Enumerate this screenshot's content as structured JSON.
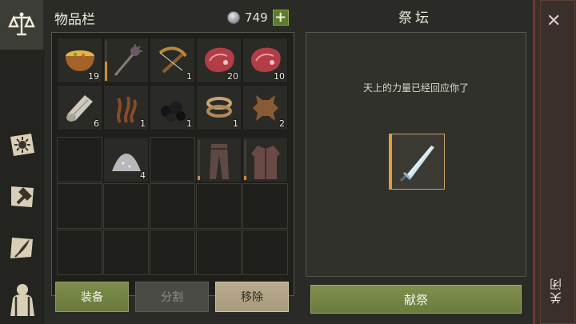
{
  "tabs": [
    {
      "icon": "scales-icon",
      "active": true
    },
    {
      "icon": "sun-scroll-icon",
      "active": false
    },
    {
      "icon": "hammer-icon",
      "active": false
    },
    {
      "icon": "quill-scroll-icon",
      "active": false
    },
    {
      "icon": "character-icon",
      "active": false
    }
  ],
  "inventory": {
    "title": "物品栏",
    "currency_value": "749",
    "plus_label": "+",
    "items_top": [
      {
        "name": "soup-bowl",
        "count": "19"
      },
      {
        "name": "mace",
        "count": "",
        "durability": 0.5
      },
      {
        "name": "crossbow",
        "count": "1"
      },
      {
        "name": "raw-meat",
        "count": "20"
      },
      {
        "name": "raw-meat",
        "count": "10"
      },
      {
        "name": "cloth-roll",
        "count": "6"
      },
      {
        "name": "seaweed",
        "count": "1"
      },
      {
        "name": "coal",
        "count": "1"
      },
      {
        "name": "rope",
        "count": "1"
      },
      {
        "name": "leather-hide",
        "count": "2"
      }
    ],
    "items_bottom": [
      {
        "name": "",
        "count": ""
      },
      {
        "name": "powder-pile",
        "count": "4"
      },
      {
        "name": "",
        "count": ""
      },
      {
        "name": "leather-pants",
        "count": "",
        "durability": 0.1
      },
      {
        "name": "leather-armor",
        "count": "",
        "durability": 0.1
      }
    ],
    "buttons": {
      "equip": "装备",
      "split": "分割",
      "remove": "移除"
    }
  },
  "altar": {
    "title": "祭坛",
    "message": "天上的力量已经回应你了",
    "offered_item": "ice-sword",
    "offer_button": "献祭"
  },
  "close": {
    "x_label": "✕",
    "label": "关闭"
  },
  "colors": {
    "accent_green": "#6f8140",
    "accent_orange": "#e39a3a",
    "close_red": "#6e3a2e"
  }
}
